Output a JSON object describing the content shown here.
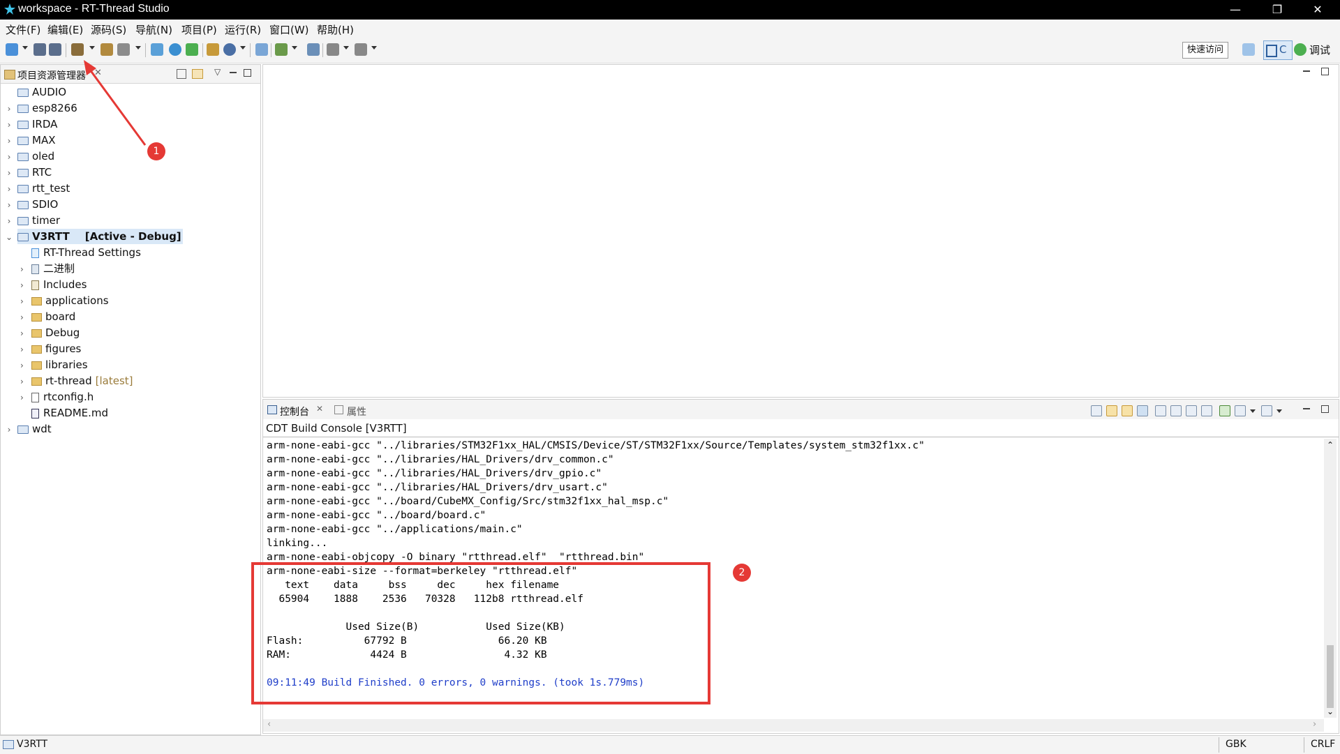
{
  "window": {
    "title": "workspace - RT-Thread Studio",
    "controls": [
      "—",
      "❐",
      "✕"
    ]
  },
  "menu": [
    "文件(F)",
    "编辑(E)",
    "源码(S)",
    "导航(N)",
    "项目(P)",
    "运行(R)",
    "窗口(W)",
    "帮助(H)"
  ],
  "toolbar": {
    "quick_access": "快速访问",
    "perspective_c": "C",
    "perspective_debug": "调试"
  },
  "explorer": {
    "title": "项目资源管理器",
    "projects": [
      {
        "name": "AUDIO",
        "chevron": ""
      },
      {
        "name": "esp8266",
        "chevron": "›"
      },
      {
        "name": "IRDA",
        "chevron": "›"
      },
      {
        "name": "MAX",
        "chevron": "›"
      },
      {
        "name": "oled",
        "chevron": "›"
      },
      {
        "name": "RTC",
        "chevron": "›"
      },
      {
        "name": "rtt_test",
        "chevron": "›"
      },
      {
        "name": "SDIO",
        "chevron": "›"
      },
      {
        "name": "timer",
        "chevron": "›"
      }
    ],
    "active_project": {
      "name": "V3RTT",
      "status": "[Active - Debug]"
    },
    "children": [
      {
        "name": "RT-Thread Settings",
        "extra": ""
      },
      {
        "name": "二进制",
        "extra": ""
      },
      {
        "name": "Includes",
        "extra": ""
      },
      {
        "name": "applications",
        "extra": ""
      },
      {
        "name": "board",
        "extra": ""
      },
      {
        "name": "Debug",
        "extra": ""
      },
      {
        "name": "figures",
        "extra": ""
      },
      {
        "name": "libraries",
        "extra": ""
      },
      {
        "name": "rt-thread",
        "extra": "[latest]"
      },
      {
        "name": "rtconfig.h",
        "extra": ""
      },
      {
        "name": "README.md",
        "extra": ""
      }
    ],
    "last_project": "wdt"
  },
  "console": {
    "tab_console": "控制台",
    "tab_properties": "属性",
    "header": "CDT Build Console [V3RTT]",
    "lines": [
      "arm-none-eabi-gcc \"../libraries/STM32F1xx_HAL/CMSIS/Device/ST/STM32F1xx/Source/Templates/system_stm32f1xx.c\"",
      "arm-none-eabi-gcc \"../libraries/HAL_Drivers/drv_common.c\"",
      "arm-none-eabi-gcc \"../libraries/HAL_Drivers/drv_gpio.c\"",
      "arm-none-eabi-gcc \"../libraries/HAL_Drivers/drv_usart.c\"",
      "arm-none-eabi-gcc \"../board/CubeMX_Config/Src/stm32f1xx_hal_msp.c\"",
      "arm-none-eabi-gcc \"../board/board.c\"",
      "arm-none-eabi-gcc \"../applications/main.c\"",
      "linking...",
      "arm-none-eabi-objcopy -O binary \"rtthread.elf\"  \"rtthread.bin\"",
      "arm-none-eabi-size --format=berkeley \"rtthread.elf\"",
      "   text    data     bss     dec     hex filename",
      "  65904    1888    2536   70328   112b8 rtthread.elf",
      "",
      "             Used Size(B)           Used Size(KB)",
      "Flash:          67792 B               66.20 KB",
      "RAM:             4424 B                4.32 KB",
      ""
    ],
    "finished": "09:11:49 Build Finished. 0 errors, 0 warnings. (took 1s.779ms)"
  },
  "annotations": {
    "first": "1",
    "second": "2",
    "color": "#e53935"
  },
  "statusbar": {
    "project": "V3RTT",
    "encoding": "GBK",
    "line_ending": "CRLF"
  }
}
